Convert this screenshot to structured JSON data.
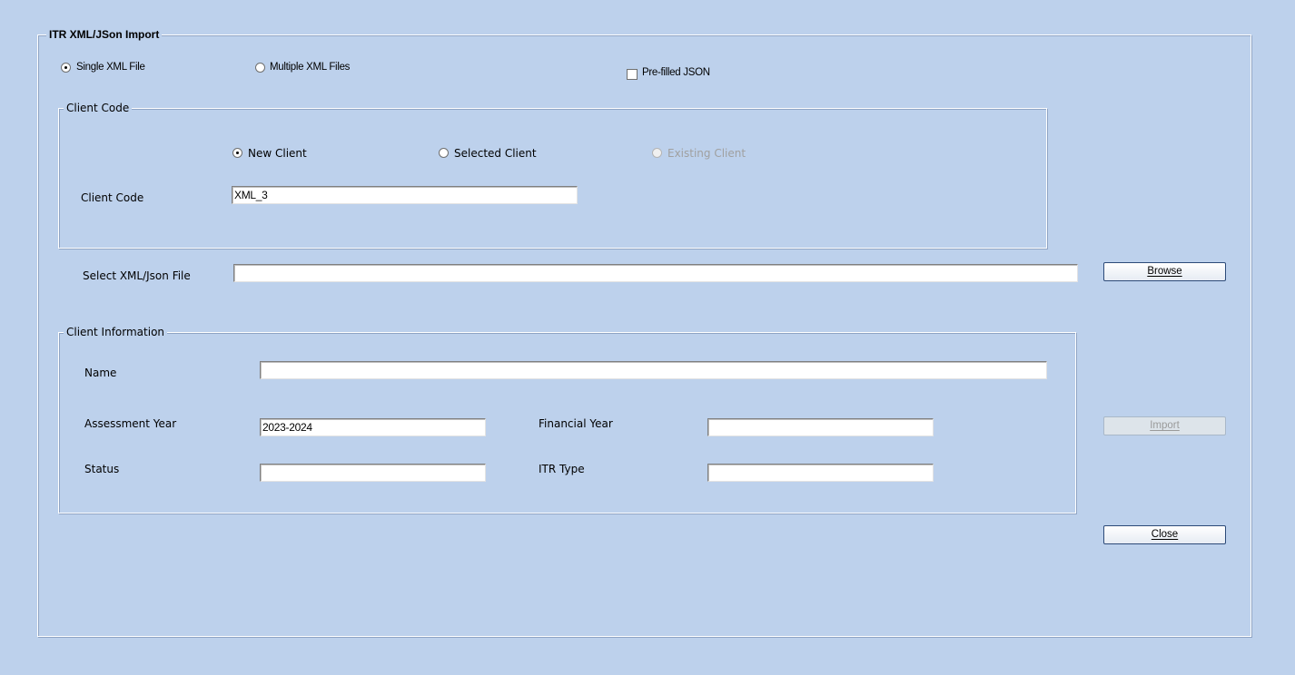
{
  "import_group": {
    "title": "ITR XML/JSon Import",
    "mode_single": "Single XML File",
    "mode_multiple": "Multiple XML Files",
    "prefilled_json": "Pre-filled JSON"
  },
  "client_code_group": {
    "title": "Client Code",
    "new_client": "New Client",
    "selected_client": "Selected Client",
    "existing_client": "Existing Client",
    "client_code_label": "Client Code",
    "client_code_value": "XML_3"
  },
  "file_select": {
    "label": "Select XML/Json File",
    "value": "",
    "browse_label": "Browse"
  },
  "client_info_group": {
    "title": "Client Information",
    "name_label": "Name",
    "name_value": "",
    "assessment_year_label": "Assessment Year",
    "assessment_year_value": "2023-2024",
    "financial_year_label": "Financial Year",
    "financial_year_value": "",
    "status_label": "Status",
    "status_value": "",
    "itr_type_label": "ITR Type",
    "itr_type_value": ""
  },
  "actions": {
    "import_label": "Import",
    "close_label": "Close"
  }
}
